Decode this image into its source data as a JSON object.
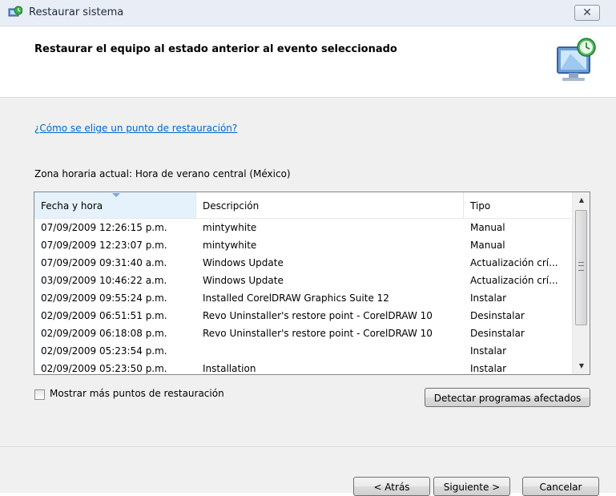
{
  "window": {
    "title": "Restaurar sistema",
    "close_label": "✕"
  },
  "header": {
    "title": "Restaurar el equipo al estado anterior al evento seleccionado"
  },
  "content": {
    "help_link": "¿Cómo se elige un punto de restauración?",
    "timezone": "Zona horaria actual: Hora de verano central (México)"
  },
  "table": {
    "columns": [
      "Fecha y hora",
      "Descripción",
      "Tipo"
    ],
    "rows": [
      {
        "date": "07/09/2009 12:26:15 p.m.",
        "desc": "mintywhite",
        "type": "Manual"
      },
      {
        "date": "07/09/2009 12:23:07 p.m.",
        "desc": "mintywhite",
        "type": "Manual"
      },
      {
        "date": "07/09/2009 09:31:40 a.m.",
        "desc": "Windows Update",
        "type": "Actualización crí..."
      },
      {
        "date": "03/09/2009 10:46:22 a.m.",
        "desc": "Windows Update",
        "type": "Actualización crí..."
      },
      {
        "date": "02/09/2009 09:55:24 p.m.",
        "desc": "Installed CorelDRAW Graphics Suite 12",
        "type": "Instalar"
      },
      {
        "date": "02/09/2009 06:51:51 p.m.",
        "desc": "Revo Uninstaller's restore point - CorelDRAW 10",
        "type": "Desinstalar"
      },
      {
        "date": "02/09/2009 06:18:08 p.m.",
        "desc": "Revo Uninstaller's restore point - CorelDRAW 10",
        "type": "Desinstalar"
      },
      {
        "date": "02/09/2009 05:23:54 p.m.",
        "desc": "",
        "type": "Instalar"
      },
      {
        "date": "02/09/2009 05:23:50 p.m.",
        "desc": "Installation",
        "type": "Instalar"
      }
    ]
  },
  "options": {
    "show_more_label": "Mostrar más puntos de restauración",
    "detect_button": "Detectar programas afectados"
  },
  "footer": {
    "back_button": "< Atrás",
    "next_button": "Siguiente >",
    "cancel_button": "Cancelar"
  },
  "icons": {
    "title_icon": "system-restore-icon",
    "header_graphic": "restore-computer-icon"
  }
}
